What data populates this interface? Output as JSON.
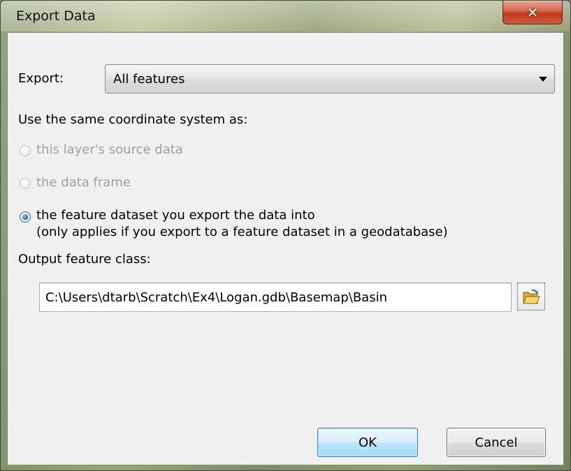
{
  "window": {
    "title": "Export Data",
    "close_glyph": "✕"
  },
  "export": {
    "label": "Export:",
    "selected": "All features"
  },
  "coordinate_system": {
    "heading": "Use the same coordinate system as:",
    "options": [
      {
        "label": "this layer's source data",
        "enabled": false,
        "checked": false
      },
      {
        "label": "the data frame",
        "enabled": false,
        "checked": false
      },
      {
        "label": "the feature dataset you export the data into",
        "label_line2": "(only applies if you export to a feature dataset in a geodatabase)",
        "enabled": true,
        "checked": true
      }
    ]
  },
  "output": {
    "label": "Output feature class:",
    "value": "C:\\Users\\dtarb\\Scratch\\Ex4\\Logan.gdb\\Basemap\\Basin",
    "browse_icon": "open-folder-icon"
  },
  "buttons": {
    "ok": "OK",
    "cancel": "Cancel"
  }
}
